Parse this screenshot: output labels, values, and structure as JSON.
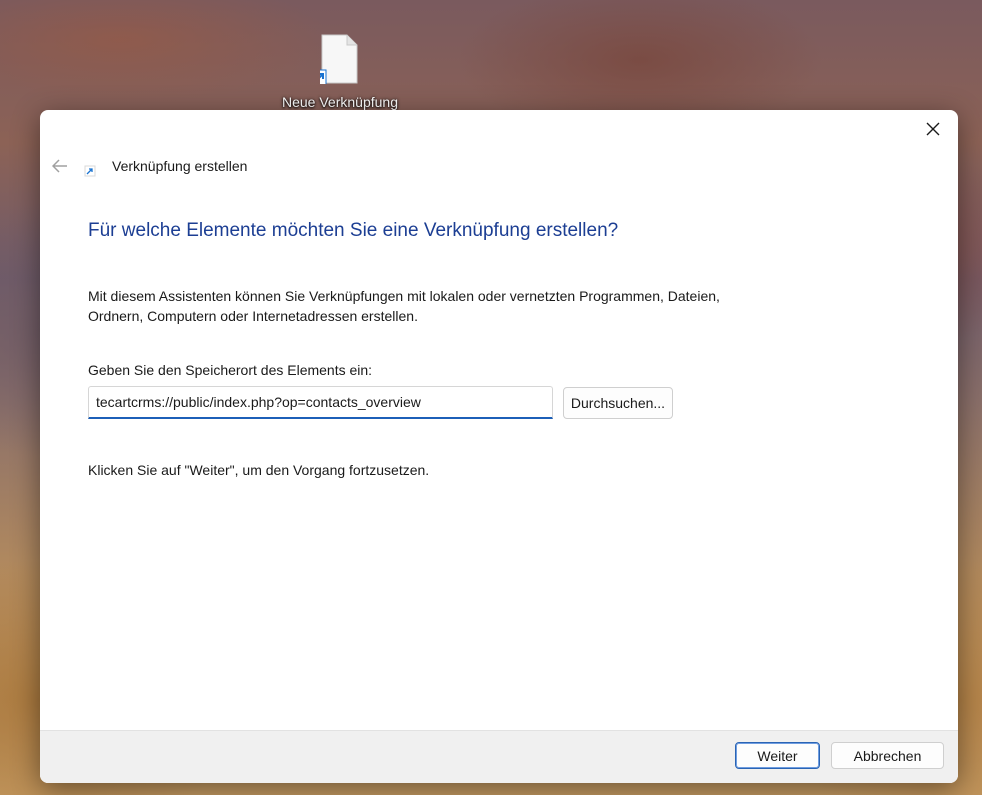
{
  "desktop": {
    "shortcut": {
      "label": "Neue Verknüpfung",
      "icon": "file-shortcut-icon"
    }
  },
  "dialog": {
    "close_icon": "close-icon",
    "back_icon": "arrow-left-icon",
    "wizard_icon": "shortcut-arrow-icon",
    "title": "Verknüpfung erstellen",
    "heading": "Für welche Elemente möchten Sie eine Verknüpfung erstellen?",
    "description": "Mit diesem Assistenten können Sie Verknüpfungen mit lokalen oder vernetzten Programmen, Dateien, Ordnern, Computern oder Internetadressen erstellen.",
    "location_label": "Geben Sie den Speicherort des Elements ein:",
    "location_value": "tecartcrms://public/index.php?op=contacts_overview",
    "browse_label": "Durchsuchen...",
    "continue_hint": "Klicken Sie auf \"Weiter\", um den Vorgang fortzusetzen.",
    "footer": {
      "next_label": "Weiter",
      "cancel_label": "Abbrechen"
    }
  },
  "colors": {
    "heading": "#1c3e93",
    "accent": "#1c5fb8",
    "footer_bg": "#f0f0f0"
  }
}
